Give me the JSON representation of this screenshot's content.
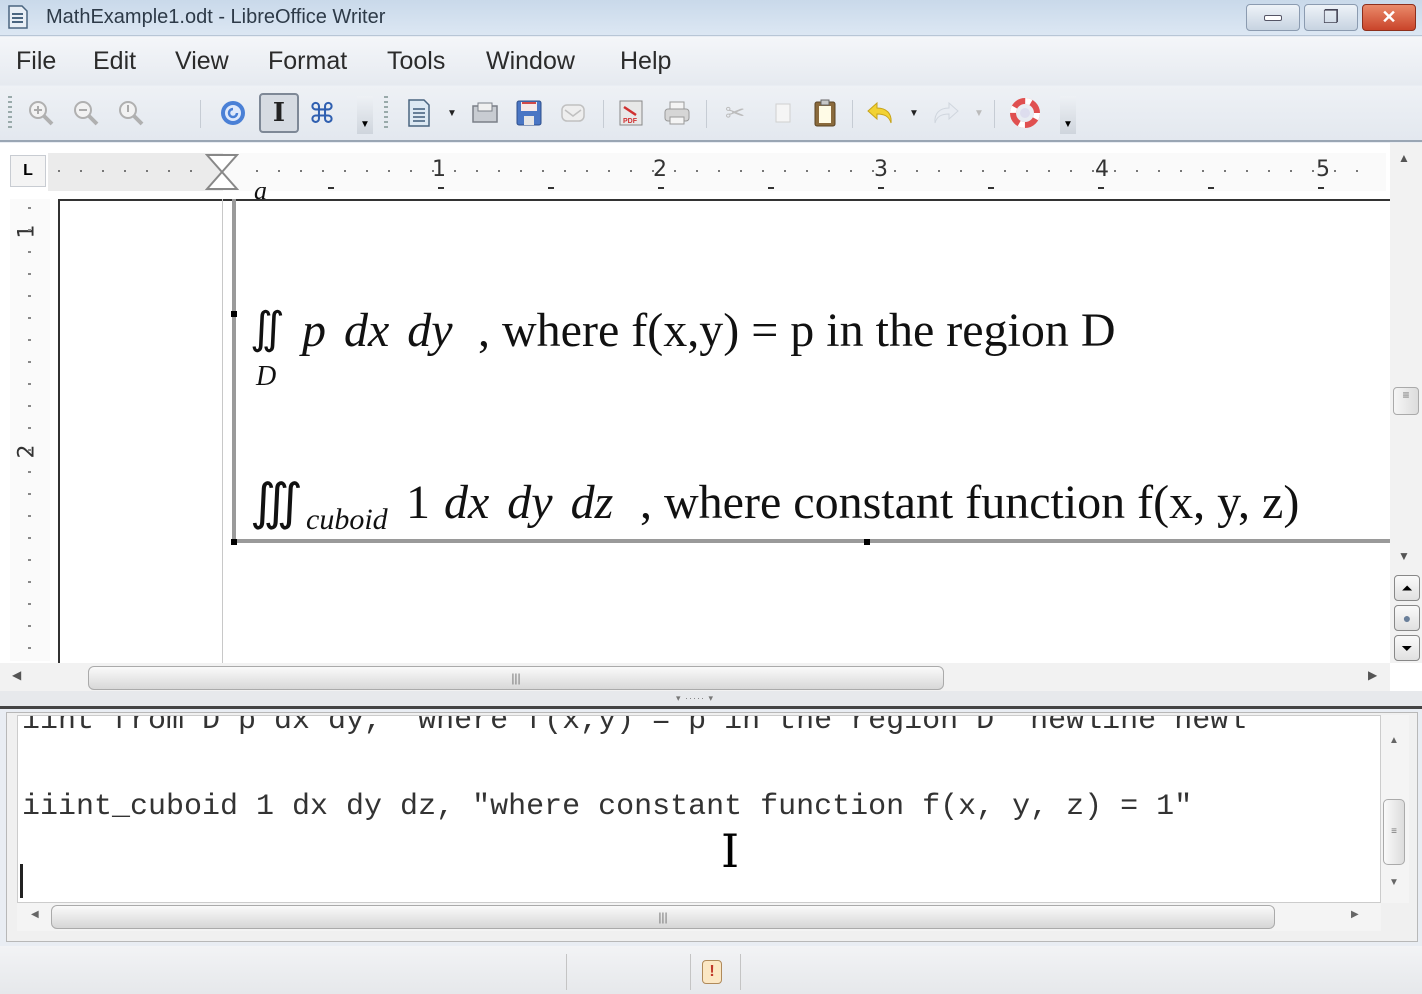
{
  "window": {
    "title": "MathExample1.odt - LibreOffice Writer",
    "controls": {
      "minimize": "—",
      "restore": "❐",
      "close": "✕"
    }
  },
  "menu": [
    {
      "label": "File",
      "mnemonic": "F"
    },
    {
      "label": "Edit",
      "mnemonic": "E"
    },
    {
      "label": "View",
      "mnemonic": "V"
    },
    {
      "label": "Format",
      "mnemonic": "o"
    },
    {
      "label": "Tools",
      "mnemonic": "T"
    },
    {
      "label": "Window",
      "mnemonic": "W"
    },
    {
      "label": "Help",
      "mnemonic": "H"
    }
  ],
  "toolbar": {
    "items": [
      {
        "name": "zoom-in-icon",
        "glyph": "🔍",
        "enabled": false
      },
      {
        "name": "zoom-out-icon",
        "glyph": "🔍",
        "enabled": false
      },
      {
        "name": "zoom-100-icon",
        "glyph": "🔍",
        "enabled": false
      },
      {
        "name": "update-icon",
        "glyph": "↻",
        "enabled": true
      },
      {
        "name": "formula-cursor-icon",
        "glyph": "I",
        "enabled": true,
        "pressed": true
      },
      {
        "name": "symbols-icon",
        "glyph": "⌘",
        "enabled": true
      },
      {
        "name": "new-document-icon",
        "glyph": "▤",
        "enabled": true
      },
      {
        "name": "open-icon",
        "glyph": "▭",
        "enabled": true
      },
      {
        "name": "save-icon",
        "glyph": "💾",
        "enabled": true
      },
      {
        "name": "email-icon",
        "glyph": "✉",
        "enabled": false
      },
      {
        "name": "export-pdf-icon",
        "glyph": "PDF",
        "enabled": true
      },
      {
        "name": "print-icon",
        "glyph": "⎙",
        "enabled": true
      },
      {
        "name": "cut-icon",
        "glyph": "✂",
        "enabled": false
      },
      {
        "name": "copy-icon",
        "glyph": "❐",
        "enabled": false
      },
      {
        "name": "paste-icon",
        "glyph": "📋",
        "enabled": true
      },
      {
        "name": "undo-icon",
        "glyph": "↶",
        "enabled": true
      },
      {
        "name": "redo-icon",
        "glyph": "↷",
        "enabled": false
      },
      {
        "name": "help-icon",
        "glyph": "⊕",
        "enabled": true
      }
    ]
  },
  "ruler": {
    "corner": "L",
    "horizontal_numbers": [
      "1",
      "2",
      "3",
      "4",
      "5"
    ],
    "vertical_numbers": [
      "1",
      "2"
    ]
  },
  "document": {
    "top_clipped": "a",
    "formula1": {
      "integral": "∬",
      "subscript": "D",
      "italic": "p dx dy",
      "rest": ", where f(x,y) = p in the region D"
    },
    "formula2": {
      "integral": "∭",
      "subscript": "cuboid",
      "one": "1",
      "italic": "dx dy dz",
      "rest": ", where constant function f(x, y, z)"
    }
  },
  "editor": {
    "line1": "iint from D p dx dy, \"where f(x,y) = p in the region D\" newline newl",
    "line2": "iiint_cuboid 1 dx dy dz, \"where constant function f(x, y, z) = 1\"",
    "line3": ""
  },
  "statusbar": {
    "warning_icon": "!"
  }
}
